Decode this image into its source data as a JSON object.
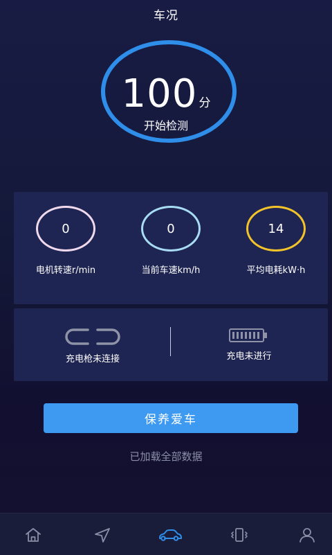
{
  "header": {
    "title": "车况"
  },
  "score": {
    "value": "100",
    "unit": "分",
    "action": "开始检测"
  },
  "stats": [
    {
      "value": "0",
      "label": "电机转速r/min",
      "ring_color": "#f0d9ec"
    },
    {
      "value": "0",
      "label": "当前车速km/h",
      "ring_color": "#a8dcf5"
    },
    {
      "value": "14",
      "label": "平均电耗kW·h",
      "ring_color": "#f3c42a"
    }
  ],
  "charging": {
    "gun_status": "充电枪未连接",
    "charge_status": "充电未进行"
  },
  "maintain_button": "保养爱车",
  "status_text": "已加载全部数据",
  "nav": {
    "items": [
      {
        "icon": "home-icon"
      },
      {
        "icon": "navigation-icon"
      },
      {
        "icon": "car-icon",
        "active": true,
        "color": "#2f8eea"
      },
      {
        "icon": "phone-vibrate-icon"
      },
      {
        "icon": "user-icon"
      }
    ]
  }
}
